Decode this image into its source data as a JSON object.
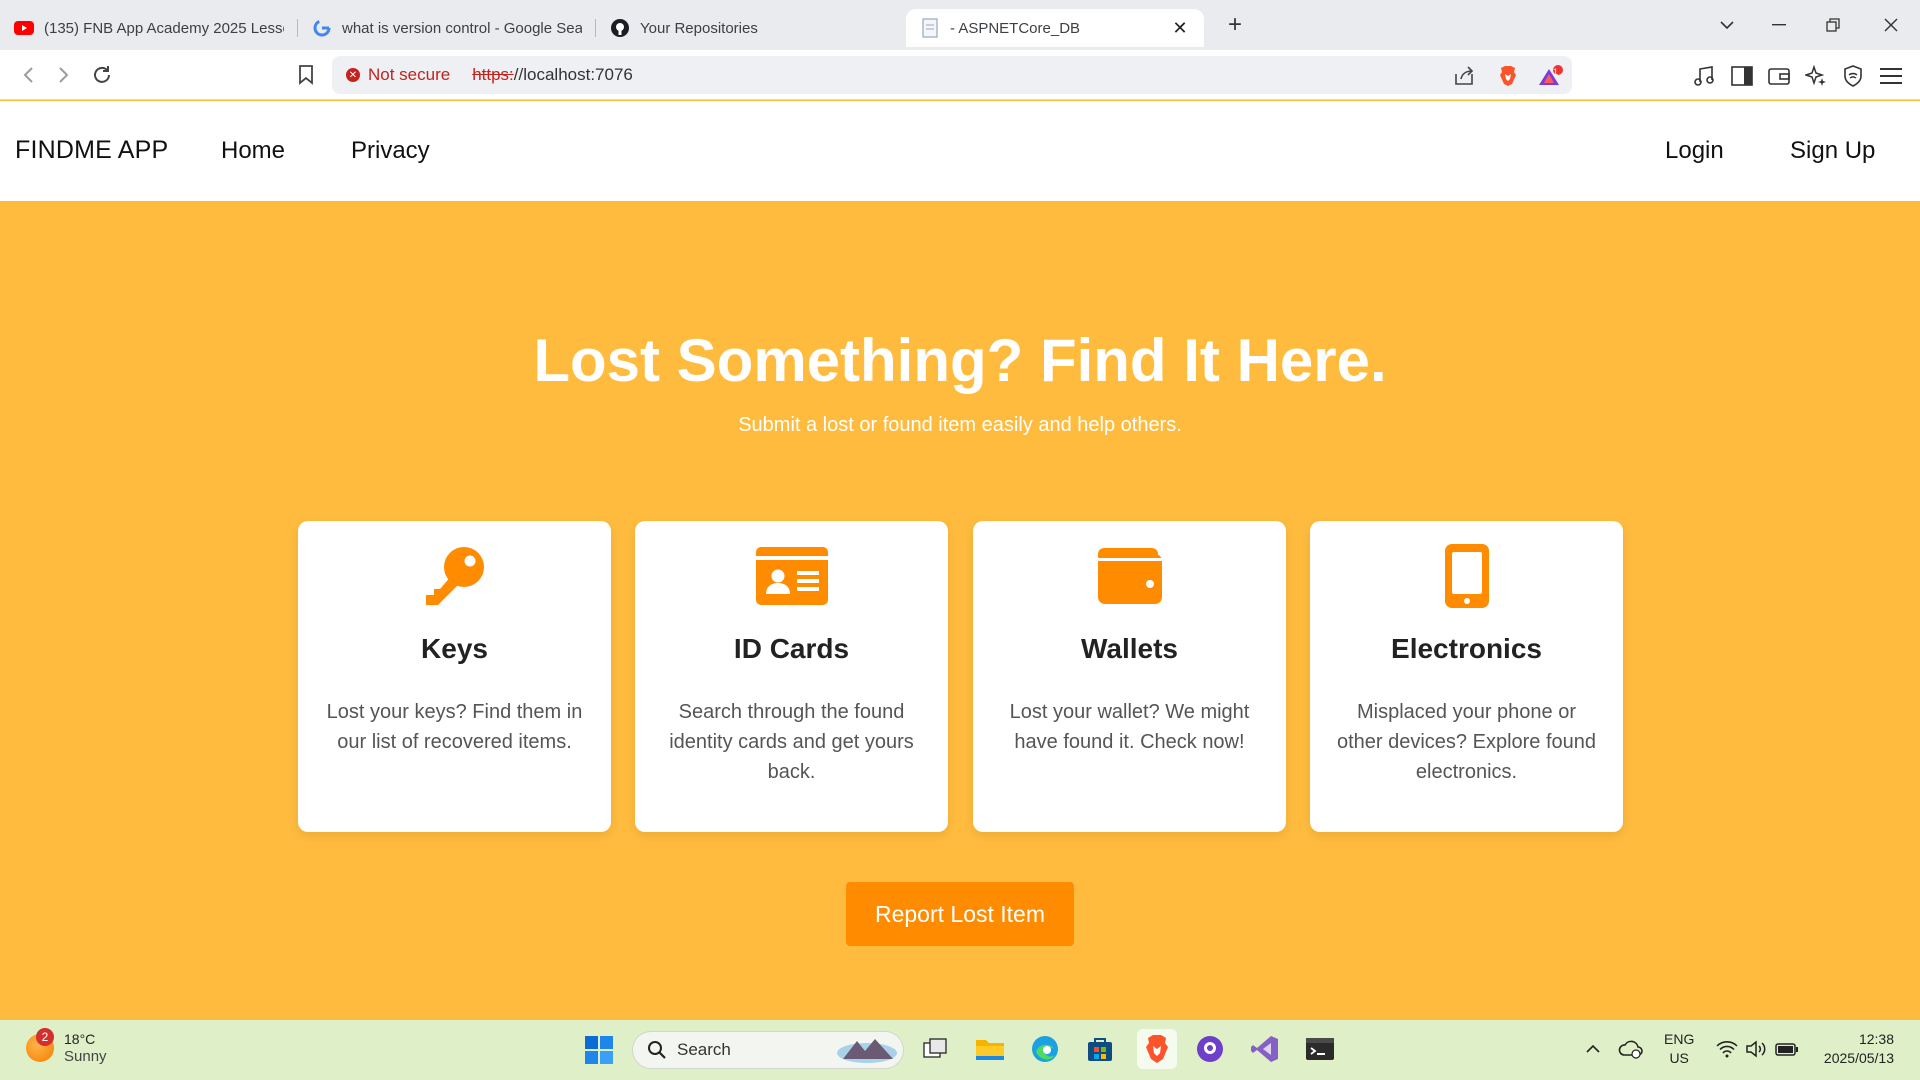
{
  "browser": {
    "tabs": [
      {
        "title": "(135) FNB App Academy 2025 Lesso",
        "icon": "youtube-icon"
      },
      {
        "title": "what is version control - Google Sea",
        "icon": "google-icon"
      },
      {
        "title": "Your Repositories",
        "icon": "github-icon"
      },
      {
        "title": "- ASPNETCore_DB",
        "icon": "page-icon"
      }
    ],
    "new_tab": "+",
    "security_label": "Not secure",
    "url_scheme": "https:",
    "url_rest": "//localhost:7076",
    "brave_rewards_count": "1"
  },
  "site": {
    "brand": "FINDME APP",
    "nav": {
      "home": "Home",
      "privacy": "Privacy",
      "login": "Login",
      "signup": "Sign Up"
    },
    "hero": {
      "title": "Lost Something? Find It Here.",
      "subtitle": "Submit a lost or found item easily and help others."
    },
    "categories": [
      {
        "title": "Keys",
        "desc": "Lost your keys? Find them in our list of recovered items.",
        "icon": "key-icon"
      },
      {
        "title": "ID Cards",
        "desc": "Search through the found identity cards and get yours back.",
        "icon": "id-card-icon"
      },
      {
        "title": "Wallets",
        "desc": "Lost your wallet? We might have found it. Check now!",
        "icon": "wallet-icon"
      },
      {
        "title": "Electronics",
        "desc": "Misplaced your phone or other devices? Explore found electronics.",
        "icon": "phone-icon"
      }
    ],
    "cta": "Report Lost Item",
    "colors": {
      "accent": "#ff8c00",
      "background": "#ffbb3d"
    }
  },
  "taskbar": {
    "weather": {
      "temp": "18°C",
      "condition": "Sunny",
      "badge": "2"
    },
    "search_label": "Search",
    "lang": {
      "line1": "ENG",
      "line2": "US"
    },
    "clock": {
      "time": "12:38",
      "date": "2025/05/13"
    }
  }
}
